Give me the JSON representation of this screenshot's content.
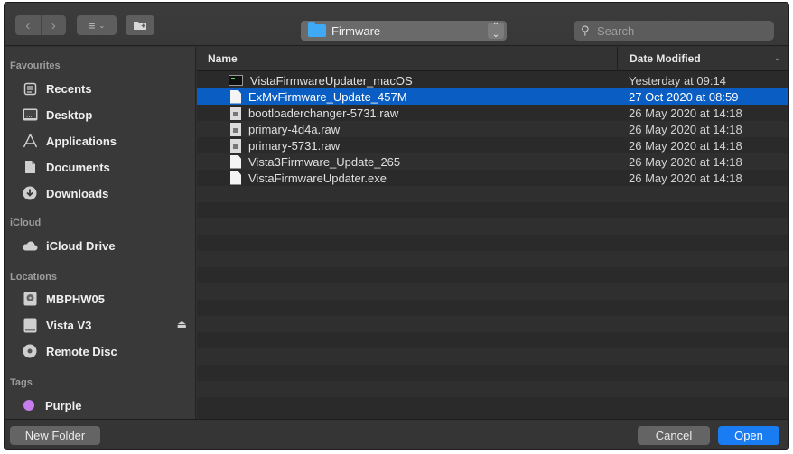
{
  "toolbar": {
    "path_label": "Firmware",
    "search_placeholder": "Search",
    "icons": [
      "back-icon",
      "forward-icon",
      "list-view-icon",
      "new-folder-icon",
      "folder-icon",
      "search-icon"
    ]
  },
  "sidebar": {
    "favourites_title": "Favourites",
    "favourites": [
      {
        "label": "Recents",
        "icon": "clock-icon"
      },
      {
        "label": "Desktop",
        "icon": "desktop-icon"
      },
      {
        "label": "Applications",
        "icon": "applications-icon"
      },
      {
        "label": "Documents",
        "icon": "documents-icon"
      },
      {
        "label": "Downloads",
        "icon": "downloads-icon"
      }
    ],
    "icloud_title": "iCloud",
    "icloud": [
      {
        "label": "iCloud Drive",
        "icon": "cloud-icon"
      }
    ],
    "locations_title": "Locations",
    "locations": [
      {
        "label": "MBPHW05",
        "icon": "hard-drive-icon"
      },
      {
        "label": "Vista V3",
        "icon": "external-drive-icon"
      },
      {
        "label": "Remote Disc",
        "icon": "disc-icon"
      }
    ],
    "tags_title": "Tags",
    "tags": [
      {
        "label": "Purple",
        "color": "#c77dec"
      }
    ]
  },
  "list": {
    "col_name": "Name",
    "col_date": "Date Modified",
    "selected_index": 1,
    "files": [
      {
        "name": "VistaFirmwareUpdater_macOS",
        "date": "Yesterday at 09:14",
        "kind": "executable"
      },
      {
        "name": "ExMvFirmware_Update_457M",
        "date": "27 Oct 2020 at 08:59",
        "kind": "document"
      },
      {
        "name": "bootloaderchanger-5731.raw",
        "date": "26 May 2020 at 14:18",
        "kind": "raw"
      },
      {
        "name": "primary-4d4a.raw",
        "date": "26 May 2020 at 14:18",
        "kind": "raw"
      },
      {
        "name": "primary-5731.raw",
        "date": "26 May 2020 at 14:18",
        "kind": "raw"
      },
      {
        "name": "Vista3Firmware_Update_265",
        "date": "26 May 2020 at 14:18",
        "kind": "document"
      },
      {
        "name": "VistaFirmwareUpdater.exe",
        "date": "26 May 2020 at 14:18",
        "kind": "document"
      }
    ]
  },
  "buttons": {
    "new_folder": "New Folder",
    "cancel": "Cancel",
    "open": "Open"
  },
  "colors": {
    "selection": "#0a5dc2",
    "primary_button": "#1a7cf2",
    "folder": "#3fa9f5"
  }
}
